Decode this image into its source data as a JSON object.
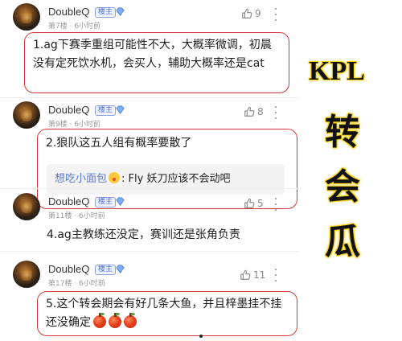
{
  "posts": [
    {
      "username": "DoubleQ",
      "badge": "楼主",
      "floor": "第7楼",
      "time": "6小时前",
      "likes": "9",
      "comment": "1.ag下赛季重组可能性不大，大概率微调，初晨没有定死饮水机，会买人，辅助大概率还是cat"
    },
    {
      "username": "DoubleQ",
      "badge": "楼主",
      "floor": "第9楼",
      "time": "6小时前",
      "likes": "8",
      "comment": "2.狼队这五人组有概率要散了",
      "reply": {
        "name": "想吃小面包",
        "separator": ":",
        "text": "Fly 妖刀应该不会动吧"
      }
    },
    {
      "username": "DoubleQ",
      "badge": "楼主",
      "floor": "第11楼",
      "time": "6小时前",
      "likes": "5",
      "comment": "4.ag主教练还没定，赛训还是张角负责"
    },
    {
      "username": "DoubleQ",
      "badge": "楼主",
      "floor": "第17楼",
      "time": "6小时前",
      "likes": "11",
      "comment": "5.这个转会期会有好几条大鱼，并且梓墨挂不挂还没确定",
      "emoji_count": 3
    }
  ],
  "side_title": {
    "line1": "KPL",
    "line2": "转",
    "line3": "会",
    "line4": "瓜"
  },
  "colors": {
    "comment_border": "#d23a3a",
    "badge_blue": "#4a6fd8",
    "side_text_glow": "#f6d21e"
  },
  "icons": [
    "avatar",
    "vip-diamond-icon",
    "thumbs-up-icon",
    "more-vertical-icon",
    "apple-emoji-icon"
  ]
}
